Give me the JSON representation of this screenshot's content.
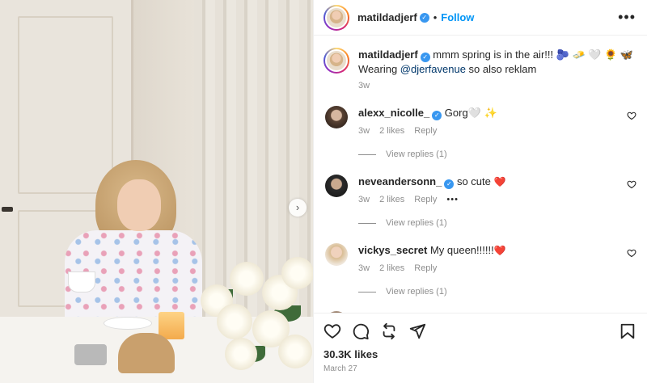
{
  "post": {
    "username": "matildadjerf",
    "follow_label": "Follow",
    "separator": "•",
    "more_label": "•••",
    "next_label": "›",
    "caption": {
      "username": "matildadjerf",
      "text_before": " mmm spring is in the air!!! 🫐 🧈 🤍 🌻 🦋",
      "text_line2": "Wearing ",
      "mention": "@djerfavenue",
      "text_after": " so also reklam",
      "time": "3w"
    },
    "comments": [
      {
        "username": "alexx_nicolle_",
        "verified": true,
        "text": "Gorg🤍 ✨",
        "time": "3w",
        "likes": "2 likes",
        "reply": "Reply",
        "view_replies": "View replies (1)"
      },
      {
        "username": "neveandersonn_",
        "verified": true,
        "text": "so cute",
        "heart": "❤️",
        "time": "3w",
        "likes": "2 likes",
        "reply": "Reply",
        "more": "•••",
        "view_replies": "View replies (1)"
      },
      {
        "username": "vickys_secret",
        "verified": false,
        "text": "My queen!!!!!!",
        "heart": "❤️",
        "time": "3w",
        "likes": "2 likes",
        "reply": "Reply",
        "view_replies": "View replies (1)"
      }
    ],
    "partial_comment": {
      "text": "❤️ ❤️ ❤️"
    },
    "likes": "30.3K likes",
    "date": "March 27"
  },
  "icons": {
    "like": "heart-icon",
    "comment": "comment-icon",
    "share": "repost-icon",
    "send": "send-icon",
    "save": "bookmark-icon"
  }
}
